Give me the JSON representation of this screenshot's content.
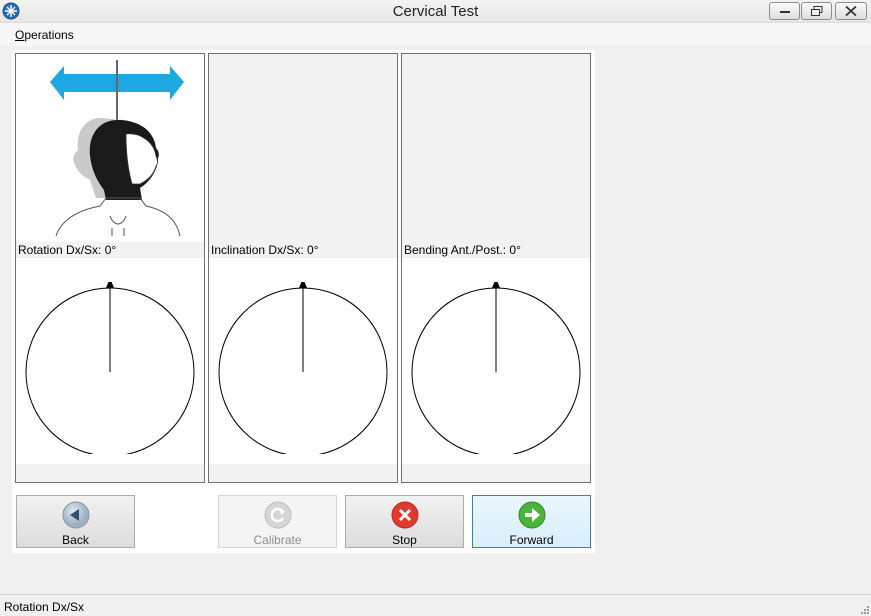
{
  "window": {
    "title": "Cervical Test"
  },
  "menu": {
    "operations_label": "Operations"
  },
  "panels": [
    {
      "label": "Rotation Dx/Sx: 0°"
    },
    {
      "label": "Inclination Dx/Sx: 0°"
    },
    {
      "label": "Bending Ant./Post.: 0°"
    }
  ],
  "buttons": {
    "back": "Back",
    "calibrate": "Calibrate",
    "stop": "Stop",
    "forward": "Forward"
  },
  "status": {
    "text": "Rotation Dx/Sx"
  },
  "colors": {
    "arrow_blue": "#1ea7e1",
    "stop_red": "#e03a2f",
    "forward_green": "#4cb43a",
    "back_blue": "#6f8fb0"
  }
}
